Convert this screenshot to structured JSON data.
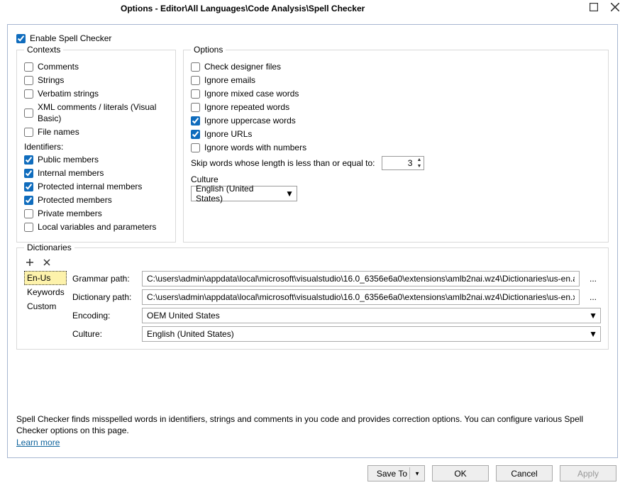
{
  "window": {
    "title": "Options - Editor\\All Languages\\Code Analysis\\Spell Checker"
  },
  "enable_spell_checker": {
    "label": "Enable Spell Checker",
    "checked": true
  },
  "contexts": {
    "legend": "Contexts",
    "items": [
      {
        "label": "Comments",
        "checked": false
      },
      {
        "label": "Strings",
        "checked": false
      },
      {
        "label": "Verbatim strings",
        "checked": false
      },
      {
        "label": "XML comments / literals (Visual Basic)",
        "checked": false
      },
      {
        "label": "File names",
        "checked": false
      }
    ],
    "identifiers_header": "Identifiers:",
    "identifiers": [
      {
        "label": "Public members",
        "checked": true
      },
      {
        "label": "Internal members",
        "checked": true
      },
      {
        "label": "Protected internal members",
        "checked": true
      },
      {
        "label": "Protected members",
        "checked": true
      },
      {
        "label": "Private members",
        "checked": false
      },
      {
        "label": "Local variables and parameters",
        "checked": false
      }
    ]
  },
  "options": {
    "legend": "Options",
    "items": [
      {
        "label": "Check designer files",
        "checked": false
      },
      {
        "label": "Ignore emails",
        "checked": false
      },
      {
        "label": "Ignore mixed case words",
        "checked": false
      },
      {
        "label": "Ignore repeated words",
        "checked": false
      },
      {
        "label": "Ignore uppercase words",
        "checked": true
      },
      {
        "label": "Ignore URLs",
        "checked": true
      },
      {
        "label": "Ignore words with numbers",
        "checked": false
      }
    ],
    "skip_label": "Skip words whose length is less than or equal to:",
    "skip_value": "3",
    "culture_label": "Culture",
    "culture_value": "English (United States)"
  },
  "dictionaries": {
    "legend": "Dictionaries",
    "list": [
      {
        "label": "En-Us",
        "selected": true
      },
      {
        "label": "Keywords",
        "selected": false
      },
      {
        "label": "Custom",
        "selected": false
      }
    ],
    "fields": {
      "grammar_path_label": "Grammar path:",
      "grammar_path_value": "C:\\users\\admin\\appdata\\local\\microsoft\\visualstudio\\16.0_6356e6a0\\extensions\\amlb2nai.wz4\\Dictionaries\\us-en.aff",
      "dictionary_path_label": "Dictionary path:",
      "dictionary_path_value": "C:\\users\\admin\\appdata\\local\\microsoft\\visualstudio\\16.0_6356e6a0\\extensions\\amlb2nai.wz4\\Dictionaries\\us-en.xlg",
      "encoding_label": "Encoding:",
      "encoding_value": "OEM United States",
      "culture_label": "Culture:",
      "culture_value": "English (United States)"
    }
  },
  "info": {
    "text": "Spell Checker finds misspelled words in identifiers, strings and comments in you code and provides correction options. You can configure various Spell Checker options on this page.",
    "learn_more": "Learn more"
  },
  "buttons": {
    "save_to": "Save To",
    "ok": "OK",
    "cancel": "Cancel",
    "apply": "Apply"
  }
}
